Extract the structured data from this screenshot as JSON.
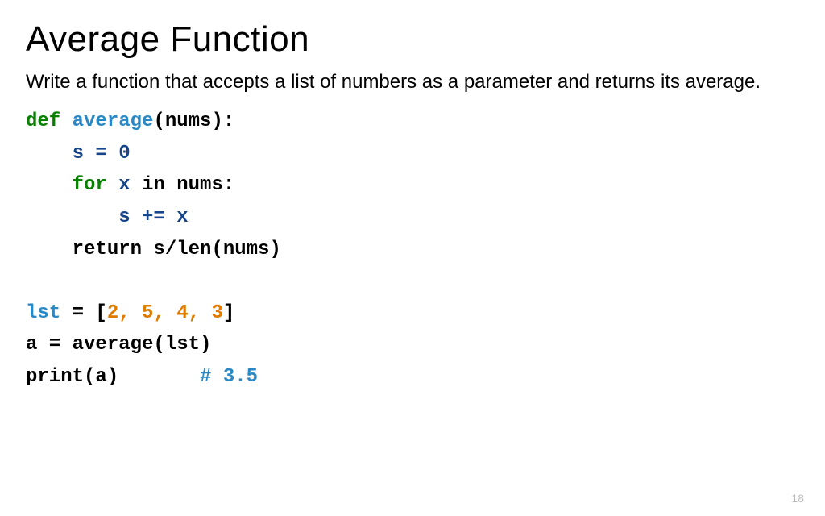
{
  "title": "Average Function",
  "description": "Write a function that accepts a list of numbers as a parameter and returns its average.",
  "code": {
    "l1a": "def",
    "l1b": " average",
    "l1c": "(nums):",
    "l2": "s = 0",
    "l3a": "for",
    "l3b": " x",
    "l3c": " in nums:",
    "l4": "s += x",
    "l5": "return s/len(nums)",
    "l6a": "lst",
    "l6b": " = [",
    "l6c": "2, 5, 4, 3",
    "l6d": "]",
    "l7": "a = average(lst)",
    "l8a": "print(a)       ",
    "l8b": "# 3.5"
  },
  "page_number": "18"
}
